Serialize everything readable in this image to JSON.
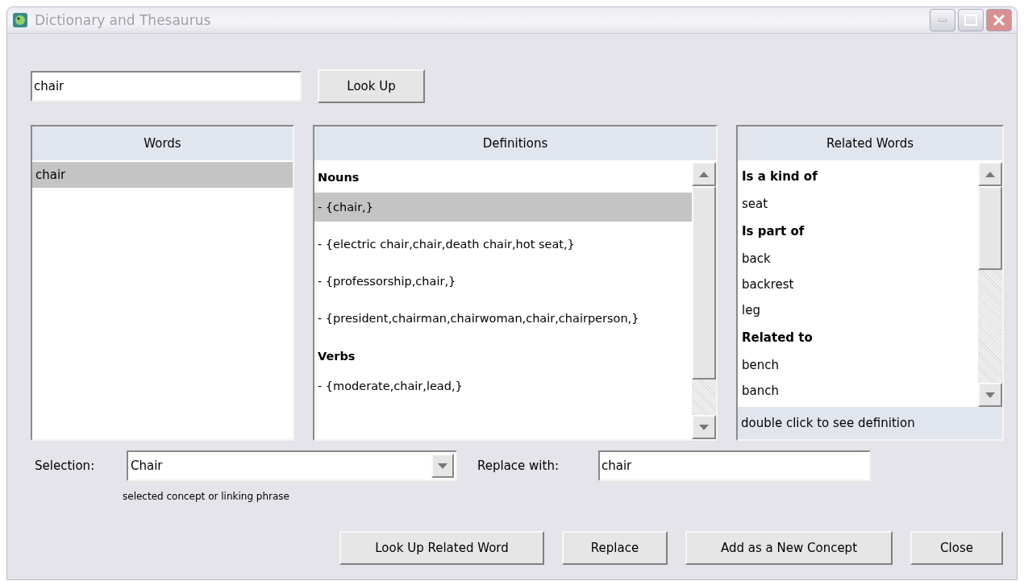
{
  "window": {
    "title": "Dictionary and Thesaurus"
  },
  "search": {
    "value": "chair",
    "button": "Look Up"
  },
  "words": {
    "header": "Words",
    "items": [
      {
        "text": "chair",
        "selected": true
      }
    ]
  },
  "definitions": {
    "header": "Definitions",
    "items": [
      {
        "kind": "heading",
        "text": "Nouns",
        "selected": false
      },
      {
        "kind": "entry",
        "text": "- {chair,}",
        "selected": true
      },
      {
        "kind": "entry",
        "text": "- {electric chair,chair,death chair,hot seat,}",
        "selected": false
      },
      {
        "kind": "entry",
        "text": "- {professorship,chair,}",
        "selected": false
      },
      {
        "kind": "entry",
        "text": "- {president,chairman,chairwoman,chair,chairperson,}",
        "selected": false
      },
      {
        "kind": "heading",
        "text": "Verbs",
        "selected": false
      },
      {
        "kind": "entry",
        "text": "- {moderate,chair,lead,}",
        "selected": false
      }
    ]
  },
  "related": {
    "header": "Related Words",
    "items": [
      {
        "kind": "heading",
        "text": "Is a kind of"
      },
      {
        "kind": "word",
        "text": "seat"
      },
      {
        "kind": "heading",
        "text": "Is part of"
      },
      {
        "kind": "word",
        "text": "back"
      },
      {
        "kind": "word",
        "text": "backrest"
      },
      {
        "kind": "word",
        "text": "leg"
      },
      {
        "kind": "heading",
        "text": "Related to"
      },
      {
        "kind": "word",
        "text": "bench"
      },
      {
        "kind": "word",
        "text": "banch"
      }
    ],
    "footer": "double click to see definition"
  },
  "selection": {
    "label": "Selection:",
    "value": "Chair",
    "hint": "selected concept or linking phrase"
  },
  "replace": {
    "label": "Replace with:",
    "value": "chair"
  },
  "buttons": [
    "Look Up Related Word",
    "Replace",
    "Add as a New Concept",
    "Close"
  ]
}
